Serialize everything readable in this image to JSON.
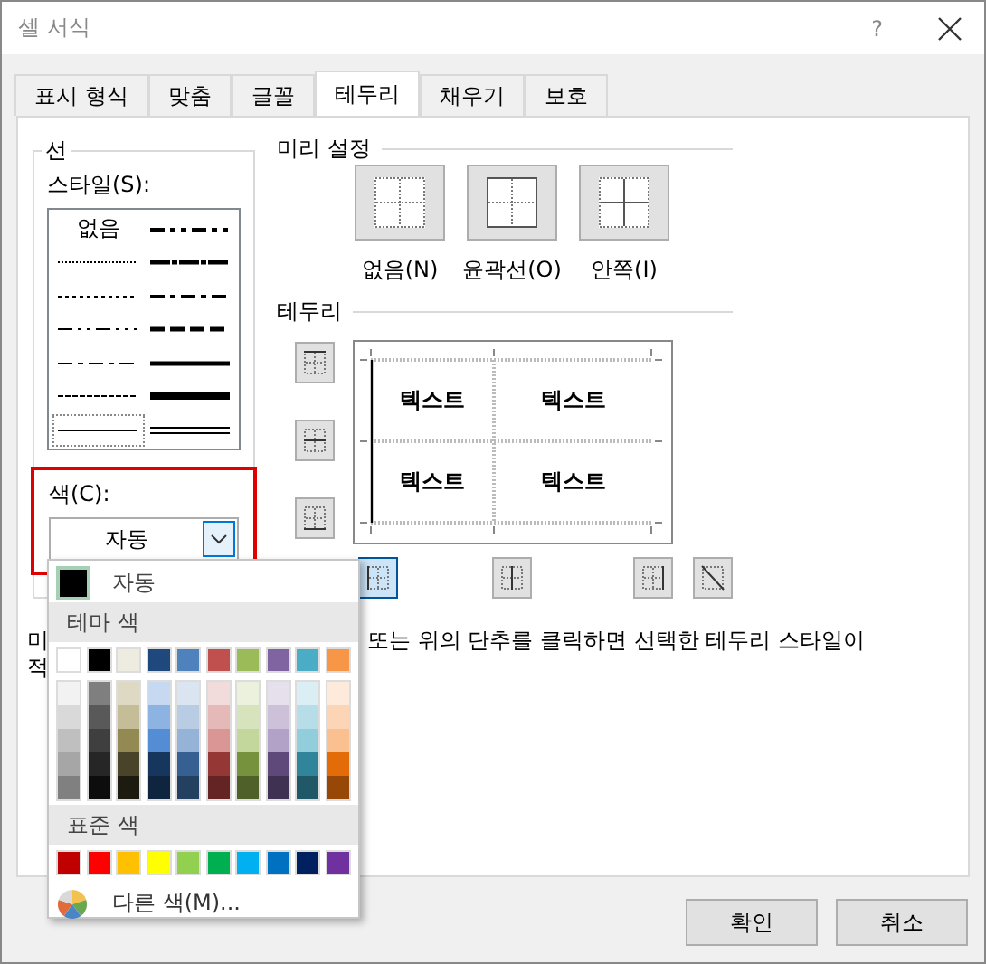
{
  "window": {
    "title": "셀 서식",
    "help": "?"
  },
  "tabs": [
    {
      "label": "표시 형식",
      "selected": false
    },
    {
      "label": "맞춤",
      "selected": false
    },
    {
      "label": "글꼴",
      "selected": false
    },
    {
      "label": "테두리",
      "selected": true
    },
    {
      "label": "채우기",
      "selected": false
    },
    {
      "label": "보호",
      "selected": false
    }
  ],
  "line": {
    "title": "선",
    "style_label": "스타일(S):",
    "styles": [
      {
        "kind": "none",
        "label": "없음",
        "selected": false
      },
      {
        "kind": "hair",
        "selected": false
      },
      {
        "kind": "dotted",
        "selected": false
      },
      {
        "kind": "dash_dot_dot",
        "selected": false
      },
      {
        "kind": "dash_dot",
        "selected": false
      },
      {
        "kind": "dashed",
        "selected": false
      },
      {
        "kind": "thin",
        "selected": true
      },
      {
        "kind": "medium_dash_dot_dot",
        "selected": false
      },
      {
        "kind": "slant_dash_dot",
        "selected": false
      },
      {
        "kind": "medium_dash_dot",
        "selected": false
      },
      {
        "kind": "medium_dashed",
        "selected": false
      },
      {
        "kind": "medium",
        "selected": false
      },
      {
        "kind": "thick",
        "selected": false
      },
      {
        "kind": "double",
        "selected": false
      }
    ],
    "color_label": "색(C):",
    "color_value": "자동",
    "highlighted": true
  },
  "presets": {
    "title": "미리 설정",
    "items": [
      {
        "kind": "none",
        "label": "없음(N)"
      },
      {
        "kind": "outline",
        "label": "윤곽선(O)"
      },
      {
        "kind": "inside",
        "label": "안쪽(I)"
      }
    ]
  },
  "border": {
    "title": "테두리",
    "side_buttons": [
      {
        "kind": "top",
        "selected": false
      },
      {
        "kind": "middle",
        "selected": false
      },
      {
        "kind": "bottom",
        "selected": false
      }
    ],
    "bottom_buttons": [
      {
        "kind": "left",
        "selected": true
      },
      {
        "kind": "center",
        "selected": false
      },
      {
        "kind": "right",
        "selected": false
      },
      {
        "kind": "diagonal",
        "selected": false
      }
    ],
    "preview_cells": [
      "텍스트",
      "텍스트",
      "텍스트",
      "텍스트"
    ]
  },
  "description": {
    "line_1_start": "미",
    "line_1_end": "또는 위의 단추를 클릭하면 선택한 테두리 스타일이",
    "line_2_start": "적"
  },
  "color_menu": {
    "automatic": {
      "label": "자동",
      "color": "#000000"
    },
    "theme_header": "테마 색",
    "theme_columns": [
      {
        "color": "#ffffff",
        "shades": [
          {
            "color": "#f2f2f2"
          },
          {
            "color": "#d9d9d9"
          },
          {
            "color": "#bfbfbf"
          },
          {
            "color": "#a6a6a6"
          },
          {
            "color": "#808080"
          }
        ]
      },
      {
        "color": "#000000",
        "shades": [
          {
            "color": "#7f7f7f"
          },
          {
            "color": "#595959"
          },
          {
            "color": "#3f3f3f"
          },
          {
            "color": "#262626"
          },
          {
            "color": "#0d0d0d"
          }
        ]
      },
      {
        "color": "#eeece1",
        "shades": [
          {
            "color": "#ddd9c3"
          },
          {
            "color": "#c4bd97"
          },
          {
            "color": "#938953"
          },
          {
            "color": "#494429"
          },
          {
            "color": "#1d1b10"
          }
        ]
      },
      {
        "color": "#1f497d",
        "shades": [
          {
            "color": "#c6d9f0"
          },
          {
            "color": "#8db3e2"
          },
          {
            "color": "#548dd4"
          },
          {
            "color": "#17365d"
          },
          {
            "color": "#0f243e"
          }
        ]
      },
      {
        "color": "#4f81bd",
        "shades": [
          {
            "color": "#dbe5f1"
          },
          {
            "color": "#b8cce4"
          },
          {
            "color": "#95b3d7"
          },
          {
            "color": "#366092"
          },
          {
            "color": "#244061"
          }
        ]
      },
      {
        "color": "#c0504d",
        "shades": [
          {
            "color": "#f2dcdb"
          },
          {
            "color": "#e5b9b7"
          },
          {
            "color": "#d99694"
          },
          {
            "color": "#953734"
          },
          {
            "color": "#632423"
          }
        ]
      },
      {
        "color": "#9bbb59",
        "shades": [
          {
            "color": "#ebf1dd"
          },
          {
            "color": "#d7e3bc"
          },
          {
            "color": "#c3d69b"
          },
          {
            "color": "#76923c"
          },
          {
            "color": "#4f6128"
          }
        ]
      },
      {
        "color": "#8064a2",
        "shades": [
          {
            "color": "#e5e0ec"
          },
          {
            "color": "#ccc1d9"
          },
          {
            "color": "#b2a2c7"
          },
          {
            "color": "#5f497a"
          },
          {
            "color": "#3f3151"
          }
        ]
      },
      {
        "color": "#4bacc6",
        "shades": [
          {
            "color": "#dbeef3"
          },
          {
            "color": "#b7dde8"
          },
          {
            "color": "#92cddc"
          },
          {
            "color": "#31859b"
          },
          {
            "color": "#205867"
          }
        ]
      },
      {
        "color": "#f79646",
        "shades": [
          {
            "color": "#fdeada"
          },
          {
            "color": "#fbd5b5"
          },
          {
            "color": "#fac08f"
          },
          {
            "color": "#e36c09"
          },
          {
            "color": "#974806"
          }
        ]
      }
    ],
    "standard_header": "표준 색",
    "standard_colors": [
      {
        "color": "#c00000"
      },
      {
        "color": "#ff0000"
      },
      {
        "color": "#ffc000"
      },
      {
        "color": "#ffff00"
      },
      {
        "color": "#92d050"
      },
      {
        "color": "#00b050"
      },
      {
        "color": "#00b0f0"
      },
      {
        "color": "#0070c0"
      },
      {
        "color": "#002060"
      },
      {
        "color": "#7030a0"
      }
    ],
    "more_colors": "다른 색(M)..."
  },
  "buttons": [
    {
      "label": "확인"
    },
    {
      "label": "취소"
    }
  ]
}
